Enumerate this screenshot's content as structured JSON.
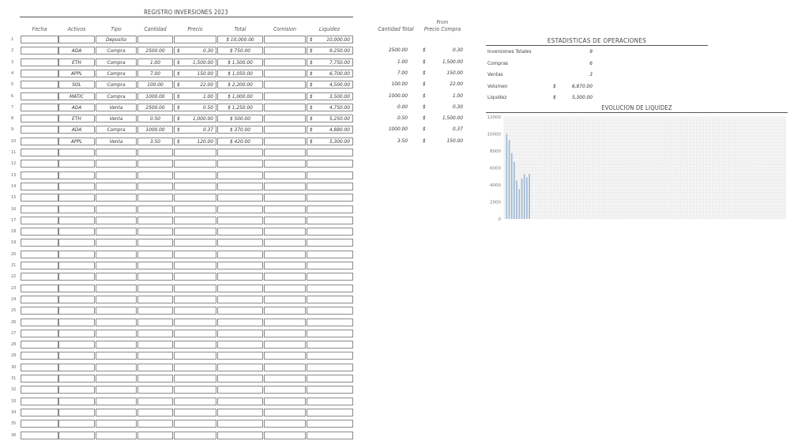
{
  "sheet": {
    "title": "REGISTRO INVERSIONES 2023",
    "headers": {
      "fecha": "Fecha",
      "activos": "Activos",
      "tipo": "Tipo",
      "cantidad": "Cantidad",
      "precio": "Precio",
      "total": "Total",
      "comision": "Comision",
      "liquidez": "Liquidez",
      "cantidad_total": "Cantidad Total",
      "prom": "Prom",
      "precio_compra": "Precio Compra"
    },
    "currency_symbol": "$",
    "row_numbers": [
      "1",
      "2",
      "3",
      "4",
      "5",
      "6",
      "7",
      "8",
      "9",
      "10",
      "11",
      "12",
      "13",
      "14",
      "15",
      "16",
      "17",
      "18",
      "19",
      "20",
      "21",
      "22",
      "23",
      "24",
      "25",
      "26",
      "27",
      "28",
      "29",
      "30",
      "31",
      "32",
      "33",
      "34",
      "35",
      "36"
    ],
    "rows": [
      {
        "fecha": "",
        "activo": "",
        "tipo": "Deposito",
        "cantidad": "",
        "precio": "",
        "total": "$ 10,000.00",
        "comision": "",
        "liquidez": "10,000.00"
      },
      {
        "fecha": "",
        "activo": "ADA",
        "tipo": "Compra",
        "cantidad": "2500.00",
        "precio": "0.30",
        "total": "$ 750.00",
        "comision": "",
        "liquidez": "9,250.00"
      },
      {
        "fecha": "",
        "activo": "ETH",
        "tipo": "Compra",
        "cantidad": "1.00",
        "precio": "1,500.00",
        "total": "$ 1,500.00",
        "comision": "",
        "liquidez": "7,750.00"
      },
      {
        "fecha": "",
        "activo": "APPL",
        "tipo": "Compra",
        "cantidad": "7.00",
        "precio": "150.00",
        "total": "$ 1,050.00",
        "comision": "",
        "liquidez": "6,700.00"
      },
      {
        "fecha": "",
        "activo": "SOL",
        "tipo": "Compra",
        "cantidad": "100.00",
        "precio": "22.00",
        "total": "$ 2,200.00",
        "comision": "",
        "liquidez": "4,500.00"
      },
      {
        "fecha": "",
        "activo": "MATIC",
        "tipo": "Compra",
        "cantidad": "1000.00",
        "precio": "1.00",
        "total": "$ 1,000.00",
        "comision": "",
        "liquidez": "3,500.00"
      },
      {
        "fecha": "",
        "activo": "ADA",
        "tipo": "Venta",
        "cantidad": "2500.00",
        "precio": "0.50",
        "total": "$ 1,250.00",
        "comision": "",
        "liquidez": "4,750.00"
      },
      {
        "fecha": "",
        "activo": "ETH",
        "tipo": "Venta",
        "cantidad": "0.50",
        "precio": "1,000.00",
        "total": "$ 500.00",
        "comision": "",
        "liquidez": "5,250.00"
      },
      {
        "fecha": "",
        "activo": "ADA",
        "tipo": "Compra",
        "cantidad": "1000.00",
        "precio": "0.37",
        "total": "$ 370.00",
        "comision": "",
        "liquidez": "4,880.00"
      },
      {
        "fecha": "",
        "activo": "APPL",
        "tipo": "Venta",
        "cantidad": "3.50",
        "precio": "120.00",
        "total": "$ 420.00",
        "comision": "",
        "liquidez": "5,300.00"
      }
    ],
    "side_rows": [
      {
        "cantidad_total": "2500.00",
        "prom_precio": "0.30"
      },
      {
        "cantidad_total": "1.00",
        "prom_precio": "1,500.00"
      },
      {
        "cantidad_total": "7.00",
        "prom_precio": "150.00"
      },
      {
        "cantidad_total": "100.00",
        "prom_precio": "22.00"
      },
      {
        "cantidad_total": "1000.00",
        "prom_precio": "1.00"
      },
      {
        "cantidad_total": "0.00",
        "prom_precio": "0.30"
      },
      {
        "cantidad_total": "0.50",
        "prom_precio": "1,500.00"
      },
      {
        "cantidad_total": "1000.00",
        "prom_precio": "0.37"
      },
      {
        "cantidad_total": "3.50",
        "prom_precio": "150.00"
      }
    ]
  },
  "stats": {
    "title": "ESTADISTICAS DE OPERACIONES",
    "items": [
      {
        "label": "Inversiones Totales",
        "value": "9",
        "currency": ""
      },
      {
        "label": "Compras",
        "value": "6",
        "currency": ""
      },
      {
        "label": "Ventas",
        "value": "3",
        "currency": ""
      },
      {
        "label": "Volumen",
        "value": "6,870.00",
        "currency": "$"
      },
      {
        "label": "Liquidez",
        "value": "5,300.00",
        "currency": "$"
      }
    ]
  },
  "chart_data": {
    "type": "bar",
    "title": "EVOLUCION DE LIQUIDEZ",
    "ylim": [
      0,
      12000
    ],
    "yticks": [
      "0",
      "2000",
      "4000",
      "6000",
      "8000",
      "10000",
      "12000"
    ],
    "values": [
      10000,
      9250,
      7750,
      6700,
      4500,
      3500,
      4750,
      5250,
      4880,
      5300
    ],
    "grid": true,
    "bar_color": "#9bb7d4"
  }
}
